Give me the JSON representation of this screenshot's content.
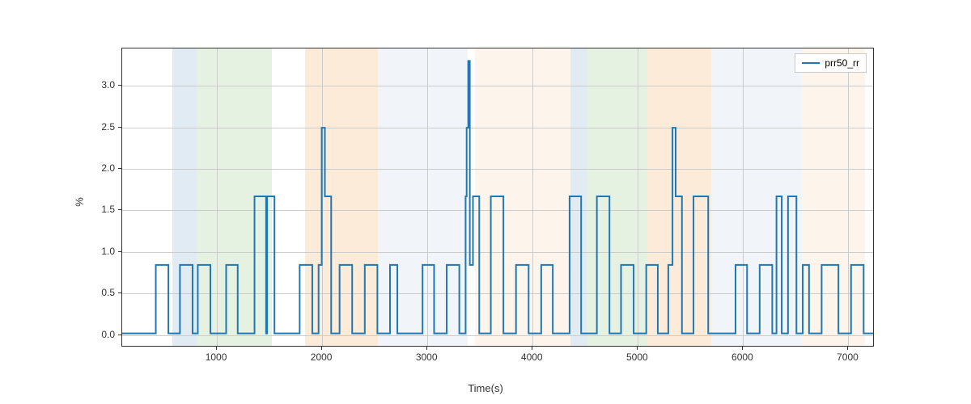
{
  "chart_data": {
    "type": "line",
    "xlabel": "Time(s)",
    "ylabel": "%",
    "xlim": [
      100,
      7250
    ],
    "ylim": [
      -0.15,
      3.45
    ],
    "xticks": [
      1000,
      2000,
      3000,
      4000,
      5000,
      6000,
      7000
    ],
    "yticks": [
      0.0,
      0.5,
      1.0,
      1.5,
      2.0,
      2.5,
      3.0
    ],
    "ytick_labels": [
      "0.0",
      "0.5",
      "1.0",
      "1.5",
      "2.0",
      "2.5",
      "3.0"
    ],
    "xtick_labels": [
      "1000",
      "2000",
      "3000",
      "4000",
      "5000",
      "6000",
      "7000"
    ],
    "legend": {
      "position": "top-right",
      "items": [
        {
          "label": "prr50_rr",
          "color": "#1f77b4"
        }
      ]
    },
    "background_regions": [
      {
        "xstart": 580,
        "xend": 810,
        "color": "#a8c5dd"
      },
      {
        "xstart": 810,
        "xend": 1520,
        "color": "#b8d9a8"
      },
      {
        "xstart": 1840,
        "xend": 2530,
        "color": "#f5c792"
      },
      {
        "xstart": 2530,
        "xend": 3380,
        "color": "#d6e0ea"
      },
      {
        "xstart": 3450,
        "xend": 4360,
        "color": "#f9e2c8"
      },
      {
        "xstart": 4360,
        "xend": 4520,
        "color": "#a8c5dd"
      },
      {
        "xstart": 4520,
        "xend": 5090,
        "color": "#b8d9a8"
      },
      {
        "xstart": 5090,
        "xend": 5700,
        "color": "#f5c792"
      },
      {
        "xstart": 5700,
        "xend": 6560,
        "color": "#d6e0ea"
      },
      {
        "xstart": 6560,
        "xend": 7160,
        "color": "#f9e2c8"
      }
    ],
    "series": [
      {
        "name": "prr50_rr",
        "color": "#1f77b4",
        "x": [
          100,
          420,
          420,
          540,
          540,
          650,
          650,
          770,
          770,
          820,
          820,
          940,
          940,
          1090,
          1090,
          1200,
          1200,
          1360,
          1360,
          1470,
          1470,
          1480,
          1480,
          1550,
          1550,
          1790,
          1790,
          1910,
          1910,
          1970,
          1970,
          2000,
          2000,
          2030,
          2030,
          2090,
          2090,
          2170,
          2170,
          2290,
          2290,
          2410,
          2410,
          2530,
          2530,
          2650,
          2650,
          2720,
          2720,
          2960,
          2960,
          3070,
          3070,
          3190,
          3190,
          3310,
          3310,
          3370,
          3370,
          3380,
          3380,
          3395,
          3395,
          3410,
          3410,
          3440,
          3440,
          3500,
          3500,
          3610,
          3610,
          3730,
          3730,
          3850,
          3850,
          3970,
          3970,
          4090,
          4090,
          4200,
          4200,
          4360,
          4360,
          4470,
          4470,
          4620,
          4620,
          4740,
          4740,
          4850,
          4850,
          4970,
          4970,
          5090,
          5090,
          5200,
          5200,
          5300,
          5300,
          5340,
          5340,
          5370,
          5370,
          5430,
          5430,
          5540,
          5540,
          5680,
          5680,
          5940,
          5940,
          6050,
          6050,
          6170,
          6170,
          6290,
          6290,
          6330,
          6330,
          6380,
          6380,
          6440,
          6440,
          6520,
          6520,
          6580,
          6580,
          6640,
          6640,
          6760,
          6760,
          6920,
          6920,
          7040,
          7040,
          7160,
          7160,
          7250
        ],
        "y": [
          0,
          0,
          0.83,
          0.83,
          0,
          0,
          0.83,
          0.83,
          0,
          0,
          0.83,
          0.83,
          0,
          0,
          0.83,
          0.83,
          0,
          0,
          1.66,
          1.66,
          0,
          0,
          1.66,
          1.66,
          0,
          0,
          0.83,
          0.83,
          0,
          0,
          0.83,
          0.83,
          2.49,
          2.49,
          1.66,
          1.66,
          0,
          0,
          0.83,
          0.83,
          0,
          0,
          0.83,
          0.83,
          0,
          0,
          0.83,
          0.83,
          0,
          0,
          0.83,
          0.83,
          0,
          0,
          0.83,
          0.83,
          0,
          0,
          1.66,
          1.66,
          2.49,
          2.49,
          3.3,
          3.3,
          0.83,
          0.83,
          1.66,
          1.66,
          0,
          0,
          1.66,
          1.66,
          0,
          0,
          0.83,
          0.83,
          0,
          0,
          0.83,
          0.83,
          0,
          0,
          1.66,
          1.66,
          0,
          0,
          1.66,
          1.66,
          0,
          0,
          0.83,
          0.83,
          0,
          0,
          0.83,
          0.83,
          0,
          0,
          0.83,
          0.83,
          2.49,
          2.49,
          1.66,
          1.66,
          0,
          0,
          1.66,
          1.66,
          0,
          0,
          0.83,
          0.83,
          0,
          0,
          0.83,
          0.83,
          0,
          0,
          1.66,
          1.66,
          0,
          0,
          1.66,
          1.66,
          0,
          0,
          0.83,
          0.83,
          0,
          0,
          0.83,
          0.83,
          0,
          0,
          0.83,
          0.83,
          0,
          0
        ]
      }
    ]
  }
}
